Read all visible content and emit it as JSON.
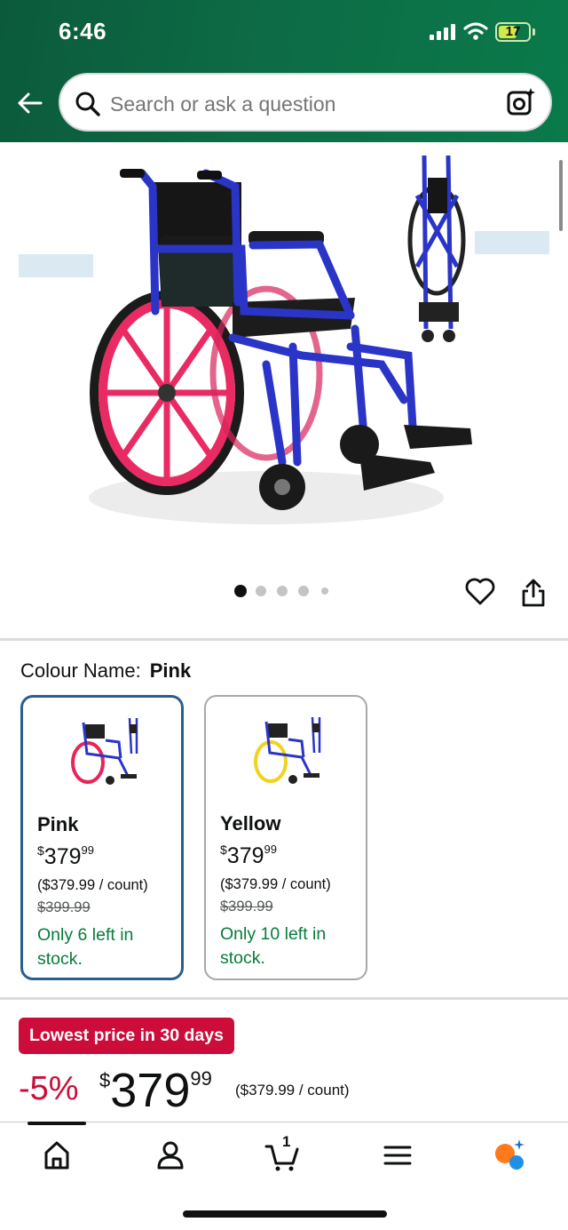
{
  "status_bar": {
    "time": "6:46",
    "battery": "17"
  },
  "header": {
    "back_icon": "back-arrow-icon",
    "search_placeholder": "Search or ask a question",
    "search_icon": "search-icon",
    "camera_icon": "camera-search-icon"
  },
  "gallery": {
    "image_count": 5,
    "active_index": 0
  },
  "colour": {
    "label": "Colour Name:",
    "selected": "Pink",
    "options": [
      {
        "name": "Pink",
        "price_currency": "$",
        "price_whole": "379",
        "price_fraction": "99",
        "unit_price": "($379.99 / count)",
        "list_price": "$399.99",
        "stock": "Only 6 left in stock.",
        "wheel_color": "#e8245a",
        "selected": true
      },
      {
        "name": "Yellow",
        "price_currency": "$",
        "price_whole": "379",
        "price_fraction": "99",
        "unit_price": "($379.99 / count)",
        "list_price": "$399.99",
        "stock": "Only 10 left in stock.",
        "wheel_color": "#f2d21f",
        "selected": false
      }
    ]
  },
  "deal": {
    "badge": "Lowest price in 30 days",
    "discount": "-5%",
    "price_currency": "$",
    "price_whole": "379",
    "price_fraction": "99",
    "unit_price": "($379.99 / count)"
  },
  "nav": {
    "cart_count": "1"
  },
  "colors": {
    "header": "#0d6b45",
    "deal_red": "#cc0c39",
    "stock_green": "#067d3a",
    "selected_border": "#2a5e8f",
    "frame_blue": "#2a35c8"
  }
}
